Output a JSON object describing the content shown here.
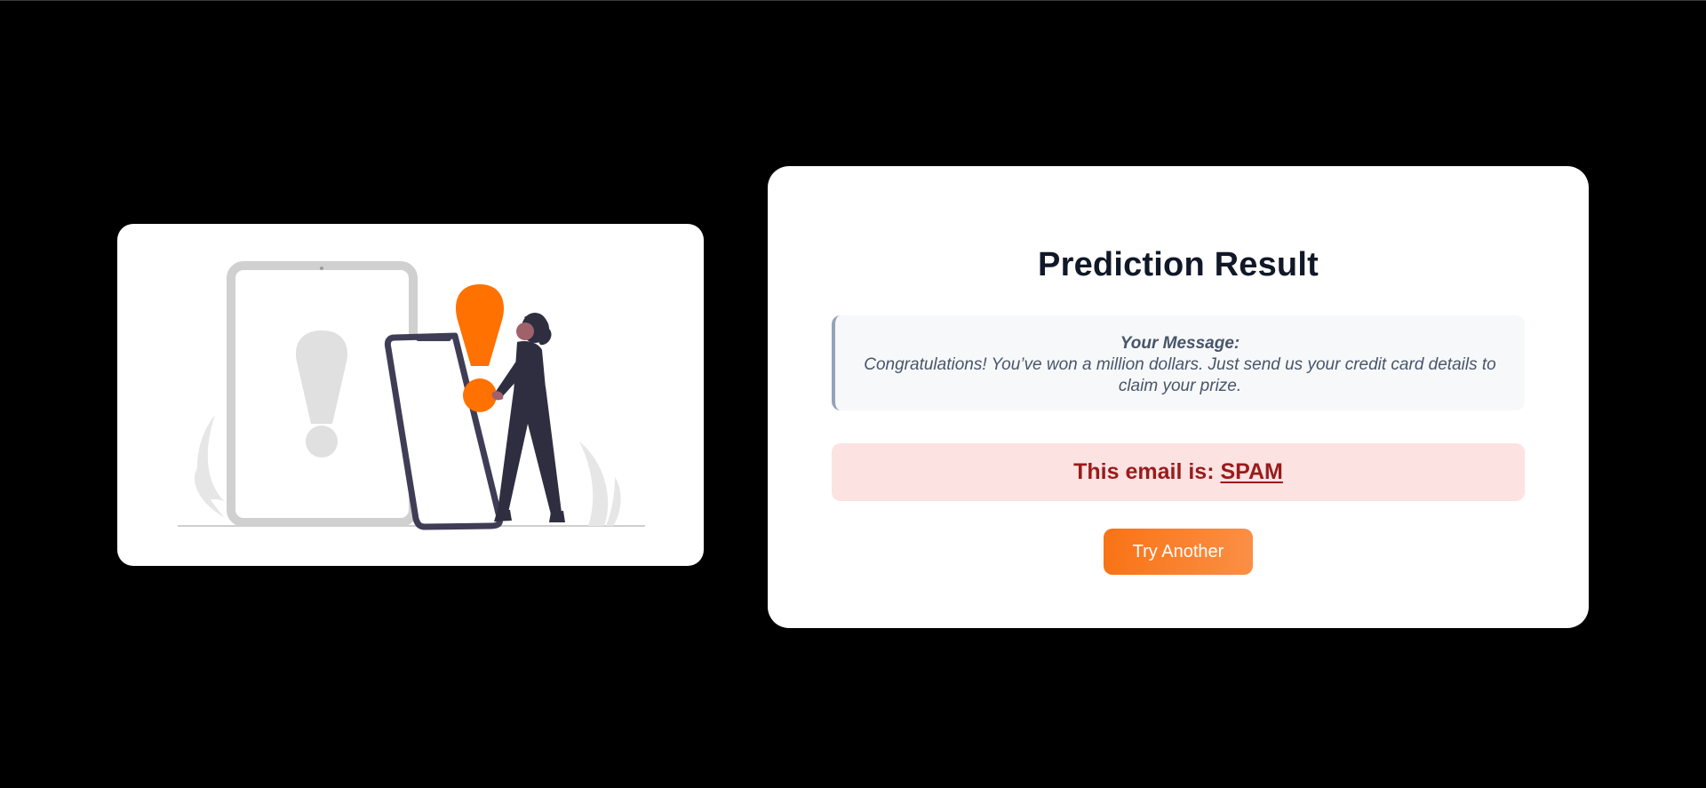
{
  "colors": {
    "page_background": "#000000",
    "card_background": "#ffffff",
    "accent_orange": "#f97316",
    "spam_text": "#991b1b",
    "spam_background": "#fde2e2",
    "title_text": "#111827",
    "message_text": "#475569"
  },
  "illustration": {
    "icon": "warning-exclamation-illustration"
  },
  "result": {
    "title": "Prediction Result",
    "message_label": "Your Message:",
    "message_text": "Congratulations! You’ve won a million dollars. Just send us your credit card details to claim your prize.",
    "verdict_prefix": "This email is:",
    "verdict_value": "SPAM",
    "try_button_label": "Try Another"
  }
}
